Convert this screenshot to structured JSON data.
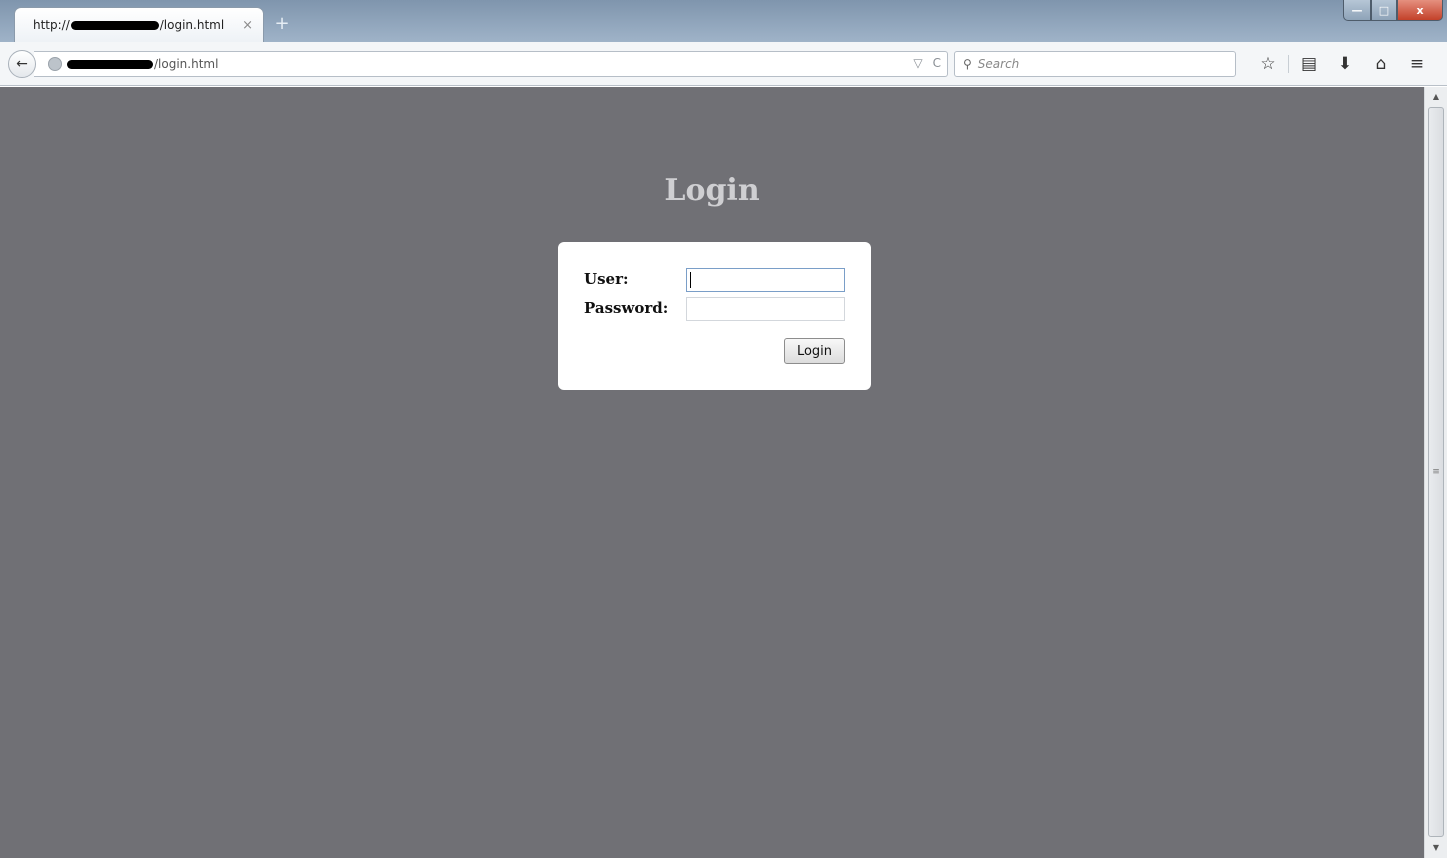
{
  "browser": {
    "tab": {
      "prefix": "http://",
      "suffix": "/login.html",
      "close_glyph": "×"
    },
    "new_tab_glyph": "+",
    "window_controls": {
      "minimize": "—",
      "maximize": "□",
      "close": "x"
    },
    "back_glyph": "←",
    "url": {
      "suffix": "/login.html",
      "dropdown_glyph": "▽",
      "reload_glyph": "C"
    },
    "search": {
      "placeholder": "Search",
      "icon_glyph": "⚲"
    },
    "toolbar": {
      "bookmark_glyph": "☆",
      "reading_list_glyph": "▤",
      "downloads_glyph": "⬇",
      "home_glyph": "⌂",
      "menu_glyph": "≡"
    }
  },
  "page": {
    "title": "Login",
    "form": {
      "user_label": "User:",
      "user_value": "",
      "password_label": "Password:",
      "password_value": "",
      "submit_label": "Login"
    }
  },
  "scrollbar": {
    "up_glyph": "▲",
    "down_glyph": "▼",
    "grip_glyph": "≡"
  },
  "colors": {
    "page_background": "#707075",
    "title_text": "#cfcfd2",
    "login_box": "#ffffff"
  }
}
